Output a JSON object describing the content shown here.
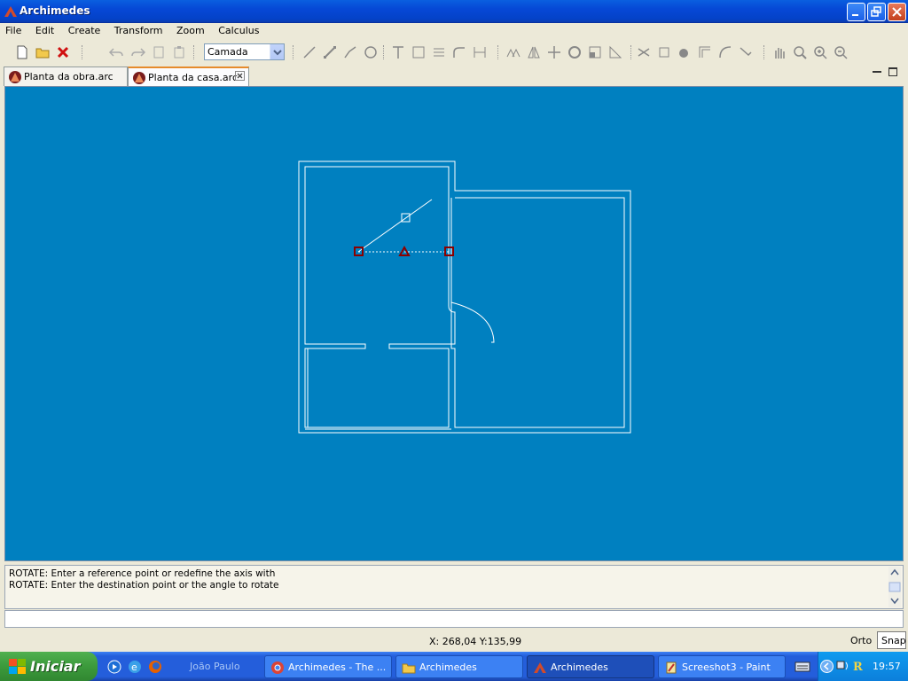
{
  "window": {
    "title": "Archimedes"
  },
  "menu": {
    "items": [
      "File",
      "Edit",
      "Create",
      "Transform",
      "Zoom",
      "Calculus"
    ]
  },
  "toolbar": {
    "layer_select_value": "Camada"
  },
  "tabs": [
    {
      "label": "Planta da obra.arc",
      "active": false
    },
    {
      "label": "Planta da casa.arc",
      "active": true
    }
  ],
  "console": {
    "lines": [
      "ROTATE: Enter a reference point or redefine the axis with",
      "ROTATE: Enter the destination point or the angle to rotate"
    ],
    "command_value": ""
  },
  "status": {
    "coordinates": "X: 268,04 Y:135,99",
    "orto_label": "Orto",
    "snap_label": "Snap"
  },
  "taskbar": {
    "start_label": "Iniciar",
    "quick_launch_user": "João Paulo",
    "tasks": [
      {
        "label": "Archimedes - The ...",
        "icon": "chrome-icon",
        "active": false
      },
      {
        "label": "Archimedes",
        "icon": "folder-icon",
        "active": false
      },
      {
        "label": "Archimedes",
        "icon": "archimedes-icon",
        "active": true
      },
      {
        "label": "Screeshot3 - Paint",
        "icon": "paint-icon",
        "active": false
      }
    ],
    "clock": "19:57"
  },
  "colors": {
    "canvas_bg": "#0080c0",
    "drawing_stroke": "#ffffff",
    "selection_marker": "#8b0000"
  }
}
